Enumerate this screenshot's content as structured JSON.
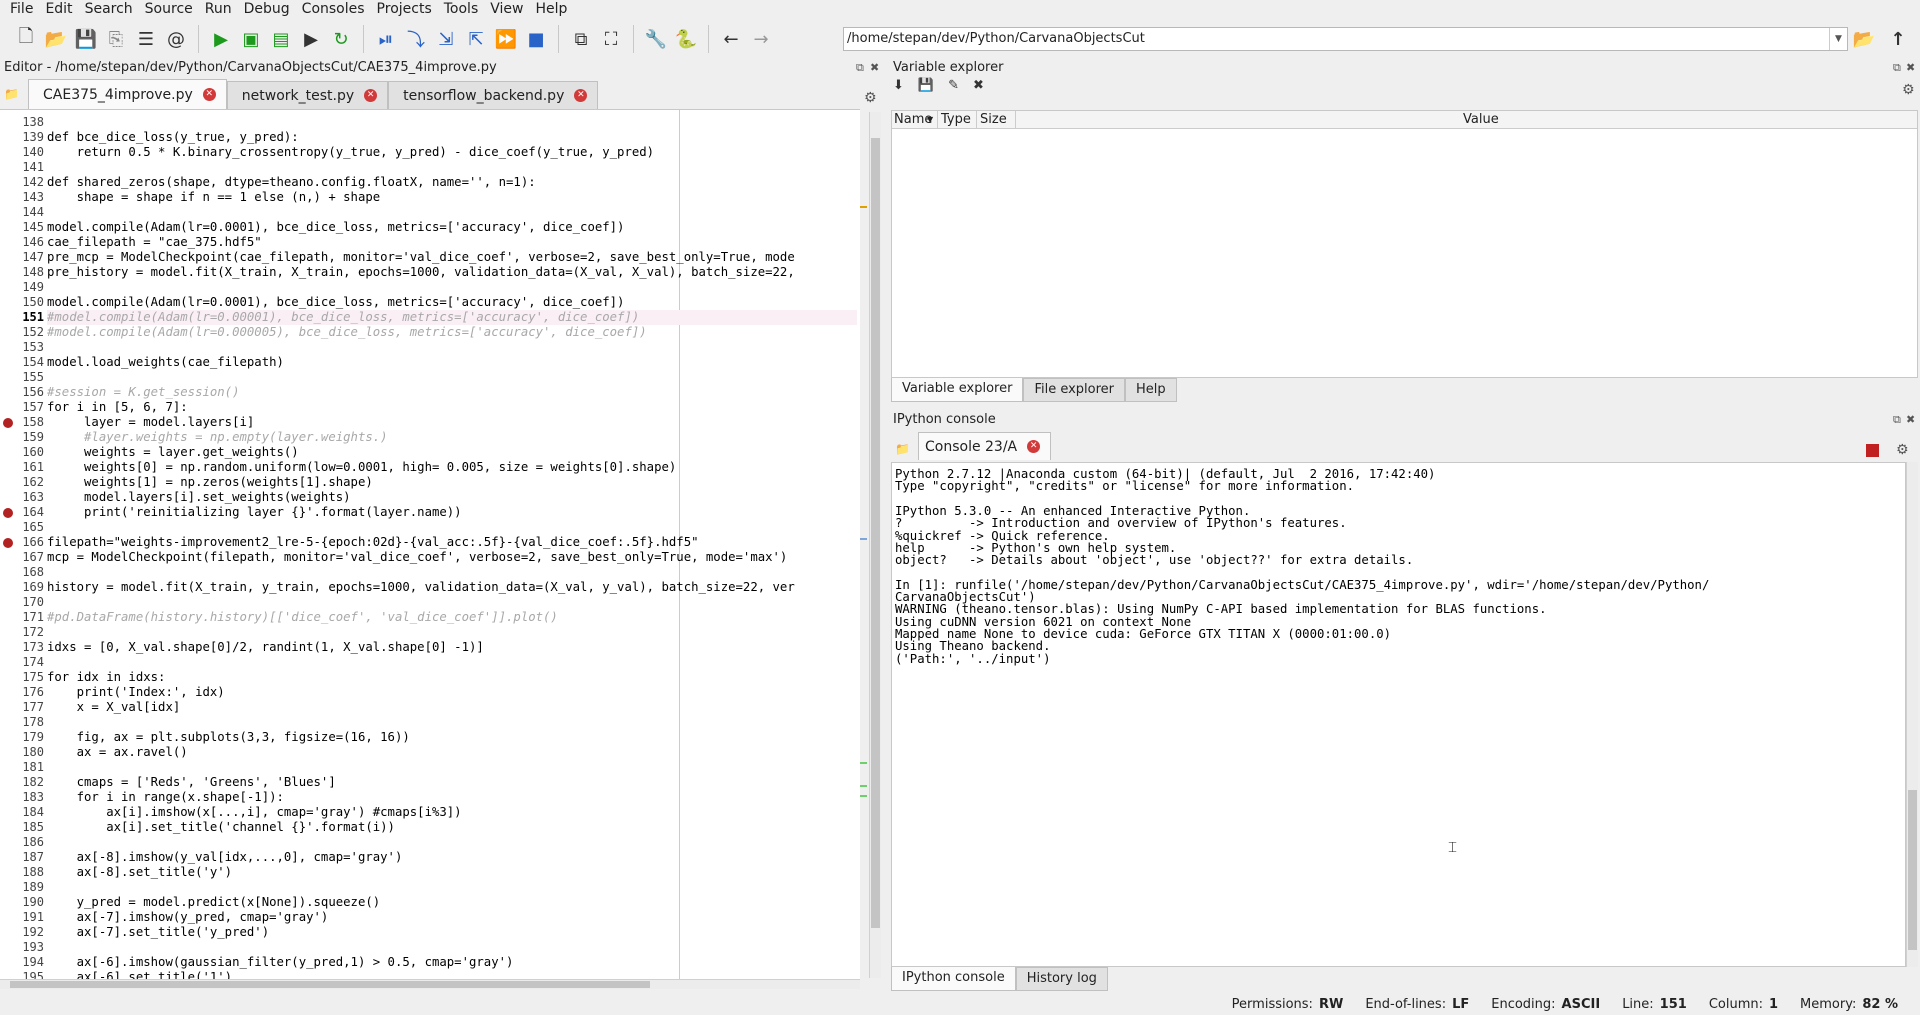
{
  "menu": [
    "File",
    "Edit",
    "Search",
    "Source",
    "Run",
    "Debug",
    "Consoles",
    "Projects",
    "Tools",
    "View",
    "Help"
  ],
  "toolbar": {
    "path": "/home/stepan/dev/Python/CarvanaObjectsCut"
  },
  "editor": {
    "title": "Editor - /home/stepan/dev/Python/CarvanaObjectsCut/CAE375_4improve.py",
    "tabs": [
      "CAE375_4improve.py",
      "network_test.py",
      "tensorflow_backend.py"
    ],
    "lines": [
      {
        "n": "138",
        "t": ""
      },
      {
        "n": "139",
        "t": "def bce_dice_loss(y_true, y_pred):"
      },
      {
        "n": "140",
        "t": "    return 0.5 * K.binary_crossentropy(y_true, y_pred) - dice_coef(y_true, y_pred)"
      },
      {
        "n": "141",
        "t": ""
      },
      {
        "n": "142",
        "t": "def shared_zeros(shape, dtype=theano.config.floatX, name='', n=1):"
      },
      {
        "n": "143",
        "t": "    shape = shape if n == 1 else (n,) + shape"
      },
      {
        "n": "144",
        "t": ""
      },
      {
        "n": "145",
        "t": "model.compile(Adam(lr=0.0001), bce_dice_loss, metrics=['accuracy', dice_coef])"
      },
      {
        "n": "146",
        "t": "cae_filepath = \"cae_375.hdf5\""
      },
      {
        "n": "147",
        "t": "pre_mcp = ModelCheckpoint(cae_filepath, monitor='val_dice_coef', verbose=2, save_best_only=True, mode"
      },
      {
        "n": "148",
        "t": "pre_history = model.fit(X_train, X_train, epochs=1000, validation_data=(X_val, X_val), batch_size=22,"
      },
      {
        "n": "149",
        "t": ""
      },
      {
        "n": "150",
        "t": "model.compile(Adam(lr=0.0001), bce_dice_loss, metrics=['accuracy', dice_coef])"
      },
      {
        "n": "151",
        "t": "#model.compile(Adam(lr=0.00001), bce_dice_loss, metrics=['accuracy', dice_coef])"
      },
      {
        "n": "152",
        "t": "#model.compile(Adam(lr=0.000005), bce_dice_loss, metrics=['accuracy', dice_coef])"
      },
      {
        "n": "153",
        "t": ""
      },
      {
        "n": "154",
        "t": "model.load_weights(cae_filepath)"
      },
      {
        "n": "155",
        "t": ""
      },
      {
        "n": "156",
        "t": "#session = K.get_session()"
      },
      {
        "n": "157",
        "t": "for i in [5, 6, 7]:"
      },
      {
        "n": "158",
        "t": "     layer = model.layers[i]"
      },
      {
        "n": "159",
        "t": "     #layer.weights = np.empty(layer.weights.)"
      },
      {
        "n": "160",
        "t": "     weights = layer.get_weights()"
      },
      {
        "n": "161",
        "t": "     weights[0] = np.random.uniform(low=0.0001, high= 0.005, size = weights[0].shape)"
      },
      {
        "n": "162",
        "t": "     weights[1] = np.zeros(weights[1].shape)"
      },
      {
        "n": "163",
        "t": "     model.layers[i].set_weights(weights)"
      },
      {
        "n": "164",
        "t": "     print('reinitializing layer {}'.format(layer.name))"
      },
      {
        "n": "165",
        "t": ""
      },
      {
        "n": "166",
        "t": "filepath=\"weights-improvement2_lre-5-{epoch:02d}-{val_acc:.5f}-{val_dice_coef:.5f}.hdf5\""
      },
      {
        "n": "167",
        "t": "mcp = ModelCheckpoint(filepath, monitor='val_dice_coef', verbose=2, save_best_only=True, mode='max')"
      },
      {
        "n": "168",
        "t": ""
      },
      {
        "n": "169",
        "t": "history = model.fit(X_train, y_train, epochs=1000, validation_data=(X_val, y_val), batch_size=22, ver"
      },
      {
        "n": "170",
        "t": ""
      },
      {
        "n": "171",
        "t": "#pd.DataFrame(history.history)[['dice_coef', 'val_dice_coef']].plot()"
      },
      {
        "n": "172",
        "t": ""
      },
      {
        "n": "173",
        "t": "idxs = [0, X_val.shape[0]/2, randint(1, X_val.shape[0] -1)]"
      },
      {
        "n": "174",
        "t": ""
      },
      {
        "n": "175",
        "t": "for idx in idxs:"
      },
      {
        "n": "176",
        "t": "    print('Index:', idx)"
      },
      {
        "n": "177",
        "t": "    x = X_val[idx]"
      },
      {
        "n": "178",
        "t": ""
      },
      {
        "n": "179",
        "t": "    fig, ax = plt.subplots(3,3, figsize=(16, 16))"
      },
      {
        "n": "180",
        "t": "    ax = ax.ravel()"
      },
      {
        "n": "181",
        "t": ""
      },
      {
        "n": "182",
        "t": "    cmaps = ['Reds', 'Greens', 'Blues']"
      },
      {
        "n": "183",
        "t": "    for i in range(x.shape[-1]):"
      },
      {
        "n": "184",
        "t": "        ax[i].imshow(x[...,i], cmap='gray') #cmaps[i%3])"
      },
      {
        "n": "185",
        "t": "        ax[i].set_title('channel {}'.format(i))"
      },
      {
        "n": "186",
        "t": ""
      },
      {
        "n": "187",
        "t": "    ax[-8].imshow(y_val[idx,...,0], cmap='gray')"
      },
      {
        "n": "188",
        "t": "    ax[-8].set_title('y')"
      },
      {
        "n": "189",
        "t": ""
      },
      {
        "n": "190",
        "t": "    y_pred = model.predict(x[None]).squeeze()"
      },
      {
        "n": "191",
        "t": "    ax[-7].imshow(y_pred, cmap='gray')"
      },
      {
        "n": "192",
        "t": "    ax[-7].set_title('y_pred')"
      },
      {
        "n": "193",
        "t": ""
      },
      {
        "n": "194",
        "t": "    ax[-6].imshow(gaussian_filter(y_pred,1) > 0.5, cmap='gray')"
      },
      {
        "n": "195",
        "t": "    ax[-6].set_title('1')"
      }
    ]
  },
  "variable_explorer": {
    "title": "Variable explorer",
    "columns": [
      "Name",
      "Type",
      "Size",
      "Value"
    ],
    "tabs": [
      "Variable explorer",
      "File explorer",
      "Help"
    ]
  },
  "ipython": {
    "title": "IPython console",
    "console_tab": "Console 23/A",
    "lines": [
      "Python 2.7.12 |Anaconda custom (64-bit)| (default, Jul  2 2016, 17:42:40)",
      "Type \"copyright\", \"credits\" or \"license\" for more information.",
      "",
      "IPython 5.3.0 -- An enhanced Interactive Python.",
      "?         -> Introduction and overview of IPython's features.",
      "%quickref -> Quick reference.",
      "help      -> Python's own help system.",
      "object?   -> Details about 'object', use 'object??' for extra details.",
      "",
      "In [1]: runfile('/home/stepan/dev/Python/CarvanaObjectsCut/CAE375_4improve.py', wdir='/home/stepan/dev/Python/",
      "CarvanaObjectsCut')",
      "WARNING (theano.tensor.blas): Using NumPy C-API based implementation for BLAS functions.",
      "Using cuDNN version 6021 on context None",
      "Mapped name None to device cuda: GeForce GTX TITAN X (0000:01:00.0)",
      "Using Theano backend.",
      "('Path:', '../input')"
    ],
    "bottom_tabs": [
      "IPython console",
      "History log"
    ]
  },
  "status": {
    "permissions_label": "Permissions:",
    "permissions": "RW",
    "eol_label": "End-of-lines:",
    "eol": "LF",
    "encoding_label": "Encoding:",
    "encoding": "ASCII",
    "line_label": "Line:",
    "line": "151",
    "column_label": "Column:",
    "column": "1",
    "memory_label": "Memory:",
    "memory": "82 %"
  }
}
